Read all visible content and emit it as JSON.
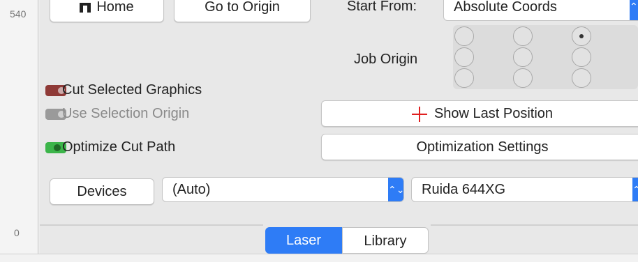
{
  "ruler": {
    "top_tick": "540",
    "bottom_tick": "0"
  },
  "top_row": {
    "home_label": "Home",
    "origin_label": "Go to Origin",
    "start_from_label": "Start From:",
    "start_from_value": "Absolute Coords"
  },
  "job_origin": {
    "label": "Job Origin",
    "selected": "top-right"
  },
  "options": [
    {
      "label": "Cut Selected Graphics",
      "color": "#8f3a37",
      "state": "off",
      "enabled": true
    },
    {
      "label": "Use Selection Origin",
      "color": "#9a9a9a",
      "state": "off",
      "enabled": false
    },
    {
      "label": "Optimize Cut Path",
      "color": "#3cb54a",
      "state": "on",
      "enabled": true
    }
  ],
  "buttons": {
    "show_last_position": "Show Last Position",
    "optimization_settings": "Optimization Settings",
    "devices": "Devices"
  },
  "device_select": {
    "port": "(Auto)",
    "controller": "Ruida 644XG"
  },
  "tabs": [
    {
      "label": "Laser",
      "active": true
    },
    {
      "label": "Library",
      "active": false
    }
  ],
  "colors": {
    "accent": "#2e7cf6",
    "crosshair": "#e02020"
  }
}
